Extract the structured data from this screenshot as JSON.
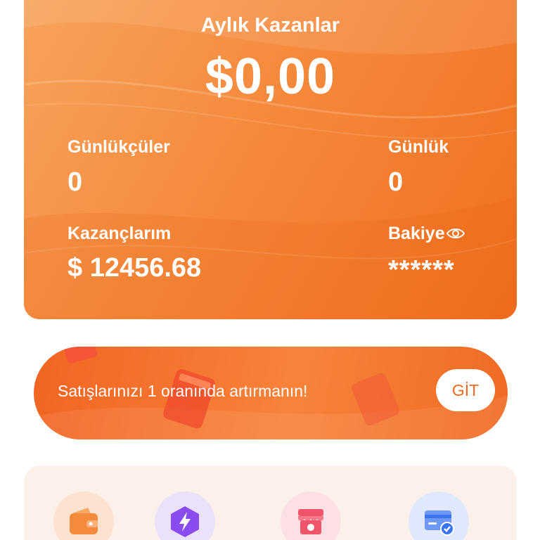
{
  "earnings_card": {
    "title": "Aylık Kazanlar",
    "amount": "$0,00",
    "stats": {
      "daily_users_label": "Günlükçüler",
      "daily_users_value": "0",
      "daily_label": "Günlük",
      "daily_value": "0",
      "earnings_label": "Kazançlarım",
      "earnings_value": "$ 12456.68",
      "balance_label": "Bakiye",
      "balance_value": "******"
    }
  },
  "promo": {
    "text": "Satışlarınızı 1 oranında artırmanın!",
    "button_label": "GİT"
  },
  "actions": {
    "items": [
      {
        "icon": "wallet-icon",
        "color": "#f58a3c"
      },
      {
        "icon": "lightning-icon",
        "color": "#8a4cf0"
      },
      {
        "icon": "store-icon",
        "color": "#f0546a"
      },
      {
        "icon": "card-check-icon",
        "color": "#3b74f0"
      }
    ]
  },
  "colors": {
    "accent_orange": "#f58a3c",
    "panel_bg": "#fbf1ea"
  }
}
